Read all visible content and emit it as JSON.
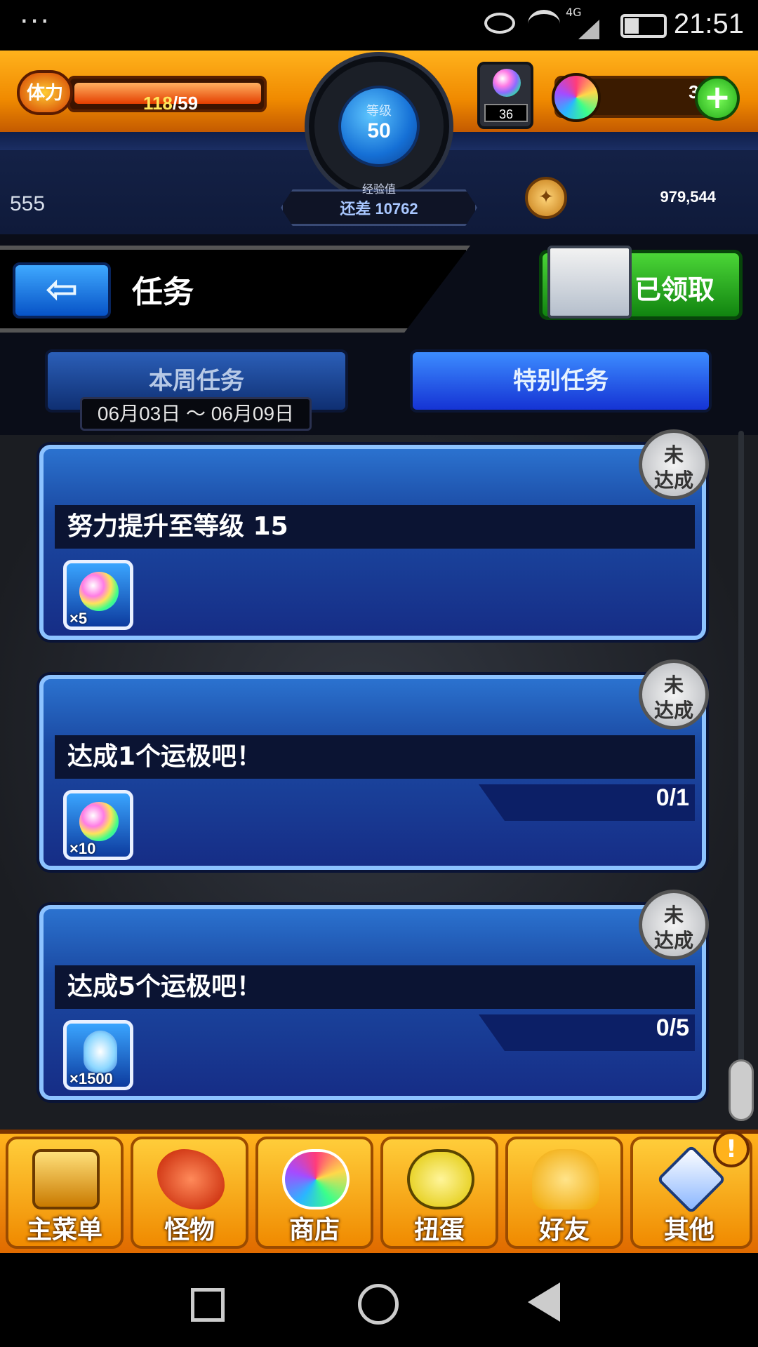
{
  "status_bar": {
    "time": "21:51",
    "network": "4G",
    "menu_dots": "···"
  },
  "header": {
    "stamina": {
      "label": "体力",
      "current": "118",
      "max": "/59",
      "fill_fraction": 0.98
    },
    "level": {
      "label": "等级",
      "value": "50"
    },
    "exp": {
      "label": "经验值",
      "remaining": "还差 10762"
    },
    "egg_count": "36",
    "orb_count": "36",
    "player_id": "555",
    "gold": "979,544"
  },
  "title_bar": {
    "title": "任务",
    "claimed_label": "已领取"
  },
  "tabs": {
    "weekly": {
      "label": "本周任务",
      "dates": "06月03日 ～ 06月09日"
    },
    "special": {
      "label": "特别任务"
    }
  },
  "missions": [
    {
      "title": "努力提升至等级 15",
      "reward_type": "orb",
      "reward_qty": "×5",
      "progress": "",
      "status": "未\n达成"
    },
    {
      "title": "达成1个运极吧！",
      "reward_type": "orb",
      "reward_qty": "×10",
      "progress": "0/1",
      "status": "未\n达成"
    },
    {
      "title": "达成5个运极吧！",
      "reward_type": "soul",
      "reward_qty": "×1500",
      "progress": "0/5",
      "status": "未\n达成"
    }
  ],
  "nav": [
    {
      "label": "主菜单",
      "icon": "gate-icon"
    },
    {
      "label": "怪物",
      "icon": "monster-icon"
    },
    {
      "label": "商店",
      "icon": "orb-icon"
    },
    {
      "label": "扭蛋",
      "icon": "egg-icon"
    },
    {
      "label": "好友",
      "icon": "friends-icon"
    },
    {
      "label": "其他",
      "icon": "other-icon"
    }
  ],
  "nav_alert": "!",
  "colors": {
    "orange": "#f08a00",
    "blue": "#1b4aa3",
    "green": "#118410"
  }
}
